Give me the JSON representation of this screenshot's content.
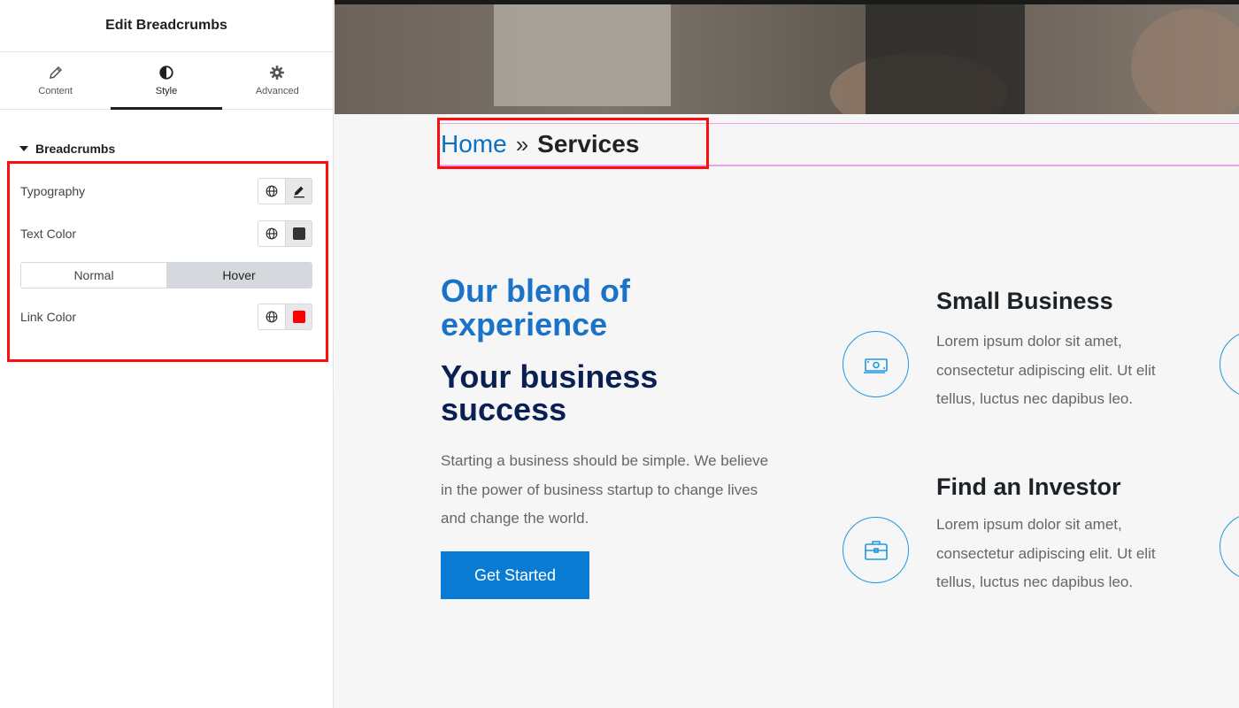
{
  "panel": {
    "title": "Edit Breadcrumbs",
    "tabs": [
      {
        "label": "Content",
        "icon": "pencil-icon"
      },
      {
        "label": "Style",
        "icon": "half-circle-icon"
      },
      {
        "label": "Advanced",
        "icon": "gear-icon"
      }
    ],
    "active_tab": "Style",
    "section": {
      "label": "Breadcrumbs",
      "icon": "caret-down-icon"
    },
    "controls": {
      "typography": {
        "label": "Typography",
        "icons": [
          "globe-icon",
          "pencil-icon"
        ]
      },
      "text_color": {
        "label": "Text Color",
        "swatch": "#333333"
      },
      "state_toggle": {
        "normal": "Normal",
        "hover": "Hover",
        "active": "Hover"
      },
      "link_color": {
        "label": "Link Color",
        "swatch": "#ff0000"
      }
    },
    "collapse_glyph": "‹"
  },
  "preview": {
    "breadcrumbs": {
      "home": "Home",
      "separator": "»",
      "current": "Services"
    },
    "heading_blue": "Our blend of experience",
    "heading_dark": "Your business success",
    "description": "Starting a business should be simple. We believe in the power of business startup to change lives and change the world.",
    "cta_label": "Get Started",
    "features": [
      {
        "title": "Small Business",
        "text": "Lorem ipsum dolor sit amet, consectetur adipiscing elit. Ut elit tellus, luctus nec dapibus leo.",
        "icon": "money-icon"
      },
      {
        "title": "Find an Investor",
        "text": "Lorem ipsum dolor sit amet, consectetur adipiscing elit. Ut elit tellus, luctus nec dapibus leo.",
        "icon": "briefcase-icon"
      }
    ]
  },
  "colors": {
    "link_blue": "#0b6fc2",
    "heading_blue": "#1a73c8",
    "heading_dark": "#0a2052",
    "cta_blue": "#0a7bd3",
    "highlight_red": "#ff0d0d"
  }
}
